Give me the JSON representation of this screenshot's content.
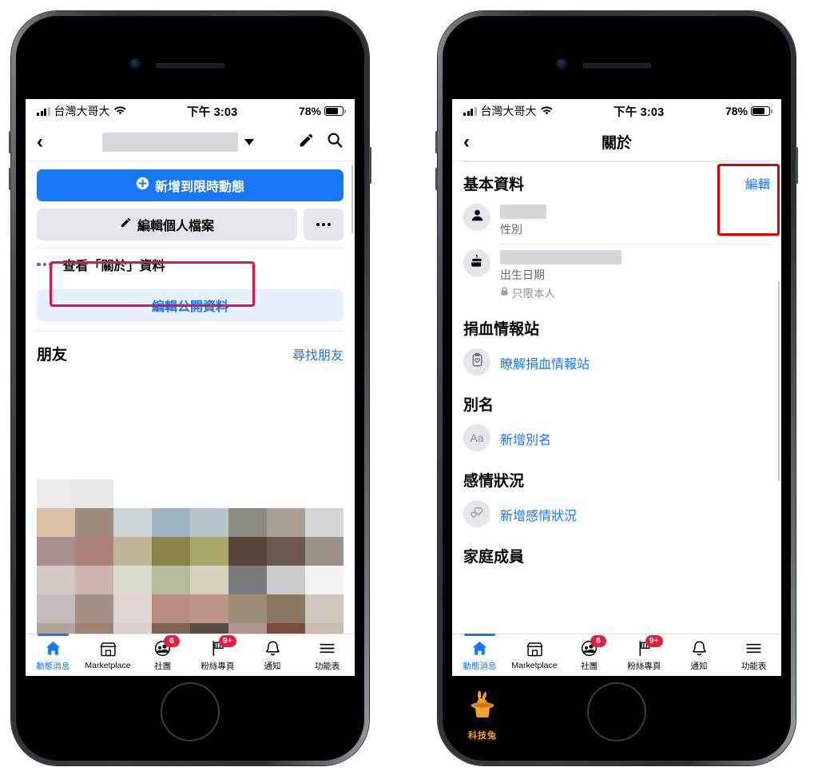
{
  "status_bar": {
    "carrier": "台灣大哥大",
    "time": "下午 3:03",
    "battery_percent": "78%",
    "wifi_icon": "wifi-icon",
    "signal_icon": "signal-bars-icon",
    "battery_icon": "battery-icon"
  },
  "colors": {
    "accent_blue": "#1877f2",
    "tinted_blue_bg": "#e7f0fd",
    "gray_button": "#e4e6eb",
    "badge_red": "#e41e3f",
    "highlight_pink": "#e8104c",
    "highlight_red": "#e00000",
    "watermark_orange": "#f0a22a"
  },
  "left_phone": {
    "nav": {
      "back_icon": "chevron-left-icon",
      "name_redacted": true,
      "dropdown_icon": "caret-down-icon",
      "edit_icon": "pencil-icon",
      "search_icon": "search-icon"
    },
    "buttons": {
      "add_to_story": "新增到限時動態",
      "add_to_story_icon": "plus-circle-icon",
      "edit_profile": "編輯個人檔案",
      "edit_profile_icon": "pencil-icon",
      "more_icon": "ellipsis-icon",
      "view_about": "查看「關於」資料",
      "view_about_icon": "ellipsis-icon",
      "edit_public_details": "編輯公開資料"
    },
    "friends": {
      "title": "朋友",
      "find_friends": "尋找朋友"
    },
    "highlight": {
      "label": "view-about-highlight"
    }
  },
  "right_phone": {
    "nav": {
      "back_icon": "chevron-left-icon",
      "title": "關於"
    },
    "sections": [
      {
        "id": "basic-info",
        "title": "基本資料",
        "action": "編輯",
        "items": [
          {
            "icon": "person-icon",
            "value_redacted": true,
            "sub": "性別",
            "privacy": null
          },
          {
            "icon": "birthday-cake-icon",
            "value_redacted": true,
            "sub": "出生日期",
            "privacy": "只限本人",
            "privacy_icon": "lock-icon"
          }
        ]
      },
      {
        "id": "blood-donation",
        "title": "捐血情報站",
        "action": null,
        "items": [
          {
            "icon": "blood-drop-icon",
            "link": "瞭解捐血情報站"
          }
        ]
      },
      {
        "id": "nickname",
        "title": "別名",
        "action": null,
        "items": [
          {
            "icon": "aa-text-icon",
            "icon_text": "Aa",
            "link": "新增別名"
          }
        ]
      },
      {
        "id": "relationship",
        "title": "感情狀況",
        "action": null,
        "items": [
          {
            "icon": "two-hearts-icon",
            "link": "新增感情狀況"
          }
        ]
      },
      {
        "id": "family-members",
        "title": "家庭成員",
        "action": null,
        "items": []
      }
    ],
    "highlight": {
      "label": "edit-link-highlight"
    }
  },
  "tab_bar": {
    "items": [
      {
        "label": "動態消息",
        "icon": "home-icon",
        "active": true,
        "badge": null
      },
      {
        "label": "Marketplace",
        "icon": "storefront-icon",
        "active": false,
        "badge": null
      },
      {
        "label": "社團",
        "icon": "groups-icon",
        "active": false,
        "badge": "6"
      },
      {
        "label": "粉絲專頁",
        "icon": "flag-icon",
        "active": false,
        "badge": "9+"
      },
      {
        "label": "通知",
        "icon": "bell-icon",
        "active": false,
        "badge": null
      },
      {
        "label": "功能表",
        "icon": "hamburger-menu-icon",
        "active": false,
        "badge": null
      }
    ]
  },
  "watermark": {
    "label": "科技兔",
    "icon": "rabbit-in-hat-icon"
  }
}
